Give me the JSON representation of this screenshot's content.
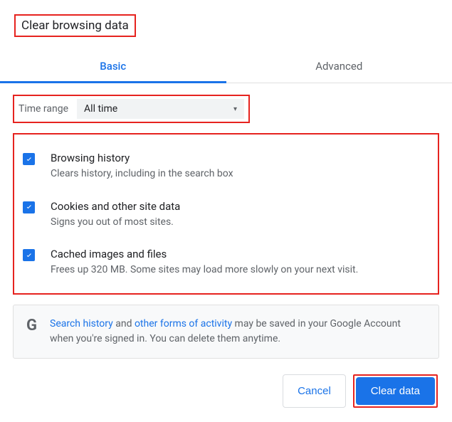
{
  "title": "Clear browsing data",
  "tabs": {
    "basic": "Basic",
    "advanced": "Advanced"
  },
  "timerange": {
    "label": "Time range",
    "value": "All time"
  },
  "options": [
    {
      "title": "Browsing history",
      "desc": "Clears history, including in the search box"
    },
    {
      "title": "Cookies and other site data",
      "desc": "Signs you out of most sites."
    },
    {
      "title": "Cached images and files",
      "desc": "Frees up 320 MB. Some sites may load more slowly on your next visit."
    }
  ],
  "info": {
    "link1": "Search history",
    "mid1": " and ",
    "link2": "other forms of activity",
    "rest": " may be saved in your Google Account when you're signed in. You can delete them anytime."
  },
  "buttons": {
    "cancel": "Cancel",
    "clear": "Clear data"
  },
  "glyphs": {
    "google": "G",
    "arrow": "▾"
  }
}
